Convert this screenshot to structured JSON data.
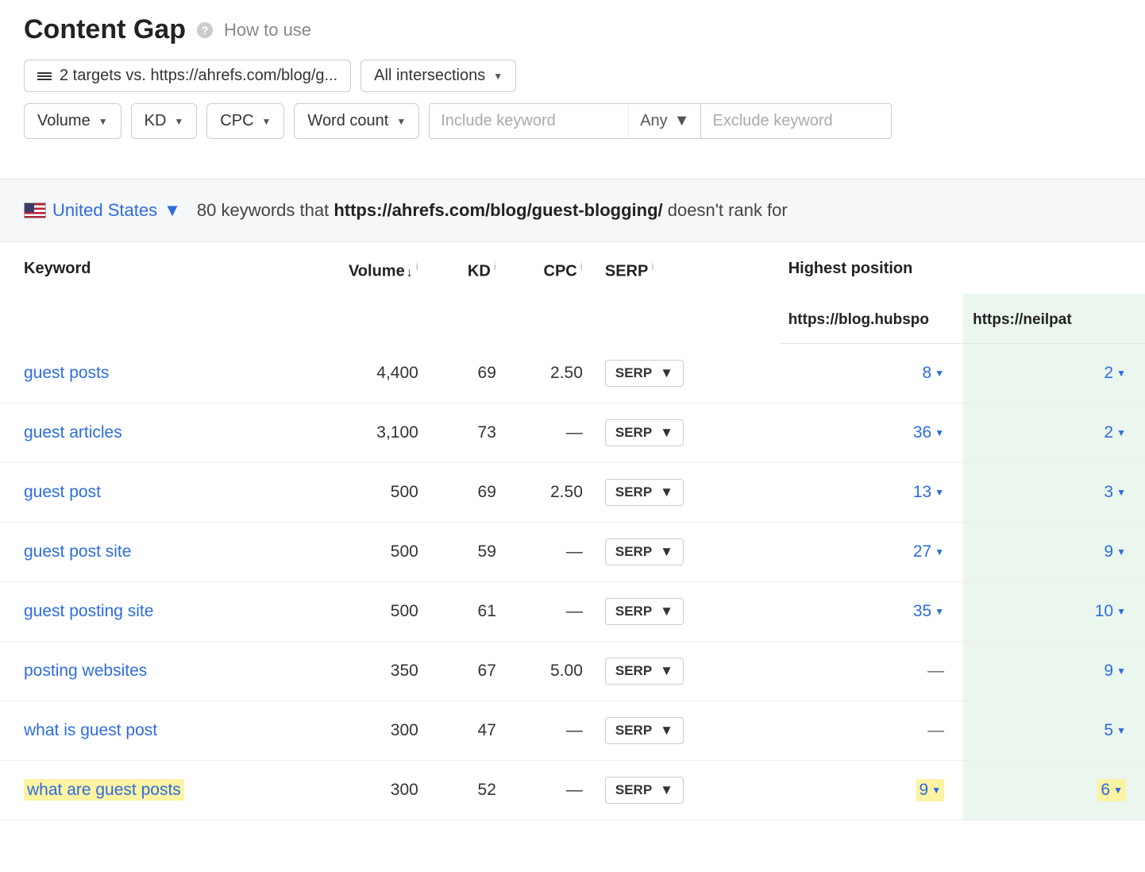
{
  "header": {
    "title": "Content Gap",
    "how_to_use": "How to use",
    "targets_label": "2 targets vs. https://ahrefs.com/blog/g...",
    "intersections_label": "All intersections"
  },
  "filters": {
    "volume": "Volume",
    "kd": "KD",
    "cpc": "CPC",
    "word_count": "Word count",
    "include_placeholder": "Include keyword",
    "any_label": "Any",
    "exclude_placeholder": "Exclude keyword"
  },
  "summary": {
    "country": "United States",
    "count": "80",
    "text_prefix": "keywords that",
    "url": "https://ahrefs.com/blog/guest-blogging/",
    "text_suffix": "doesn't rank for"
  },
  "columns": {
    "keyword": "Keyword",
    "volume": "Volume",
    "kd": "KD",
    "cpc": "CPC",
    "serp": "SERP",
    "highest_position": "Highest position",
    "site1": "https://blog.hubspo",
    "site2": "https://neilpat"
  },
  "serp_button": "SERP",
  "rows": [
    {
      "keyword": "guest posts",
      "volume": "4,400",
      "kd": "69",
      "cpc": "2.50",
      "pos1": "8",
      "pos2": "2",
      "highlight": false
    },
    {
      "keyword": "guest articles",
      "volume": "3,100",
      "kd": "73",
      "cpc": "—",
      "pos1": "36",
      "pos2": "2",
      "highlight": false
    },
    {
      "keyword": "guest post",
      "volume": "500",
      "kd": "69",
      "cpc": "2.50",
      "pos1": "13",
      "pos2": "3",
      "highlight": false
    },
    {
      "keyword": "guest post site",
      "volume": "500",
      "kd": "59",
      "cpc": "—",
      "pos1": "27",
      "pos2": "9",
      "highlight": false
    },
    {
      "keyword": "guest posting site",
      "volume": "500",
      "kd": "61",
      "cpc": "—",
      "pos1": "35",
      "pos2": "10",
      "highlight": false
    },
    {
      "keyword": "posting websites",
      "volume": "350",
      "kd": "67",
      "cpc": "5.00",
      "pos1": "—",
      "pos2": "9",
      "highlight": false
    },
    {
      "keyword": "what is guest post",
      "volume": "300",
      "kd": "47",
      "cpc": "—",
      "pos1": "—",
      "pos2": "5",
      "highlight": false
    },
    {
      "keyword": "what are guest posts",
      "volume": "300",
      "kd": "52",
      "cpc": "—",
      "pos1": "9",
      "pos2": "6",
      "highlight": true
    }
  ]
}
